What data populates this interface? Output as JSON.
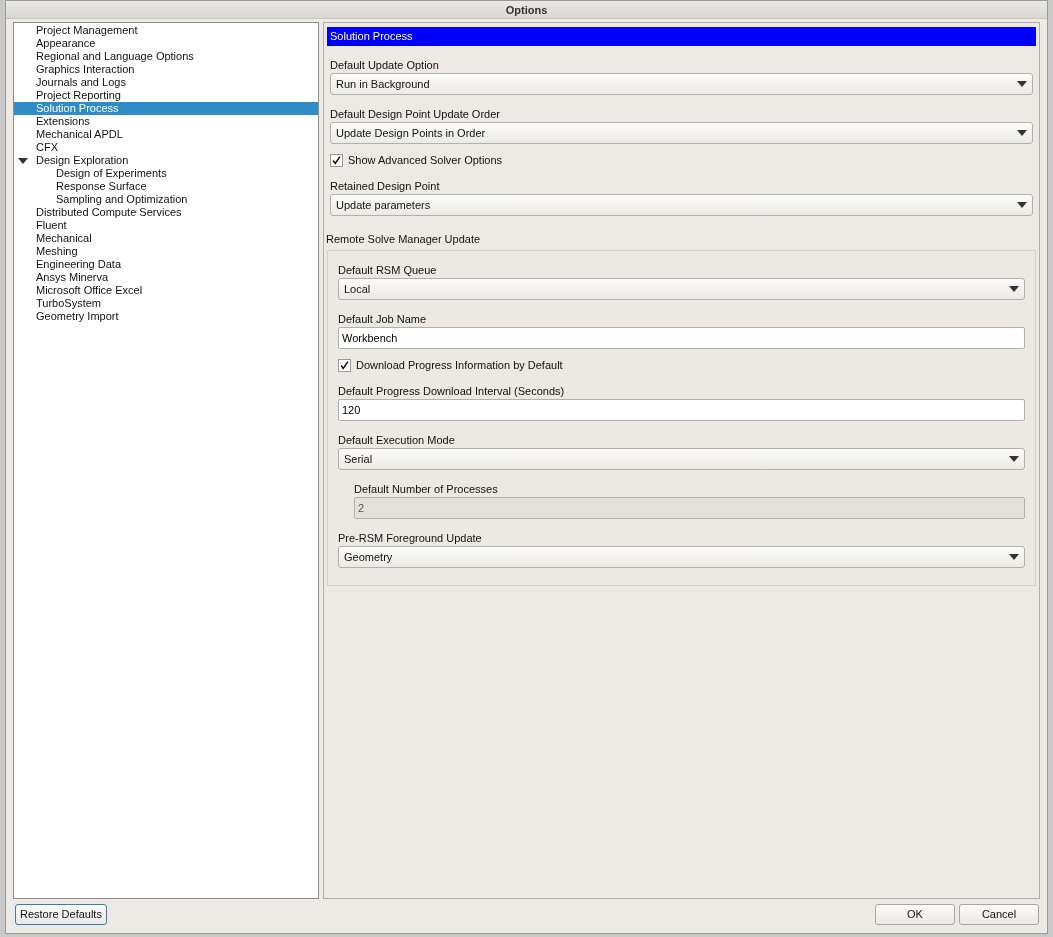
{
  "window": {
    "title": "Options"
  },
  "tree": [
    {
      "label": "Project Management",
      "selected": false
    },
    {
      "label": "Appearance",
      "selected": false
    },
    {
      "label": "Regional and Language Options",
      "selected": false
    },
    {
      "label": "Graphics Interaction",
      "selected": false
    },
    {
      "label": "Journals and Logs",
      "selected": false
    },
    {
      "label": "Project Reporting",
      "selected": false
    },
    {
      "label": "Solution Process",
      "selected": true
    },
    {
      "label": "Extensions",
      "selected": false
    },
    {
      "label": "Mechanical APDL",
      "selected": false
    },
    {
      "label": "CFX",
      "selected": false
    },
    {
      "label": "Design Exploration",
      "selected": false,
      "expanded": true,
      "children": [
        {
          "label": "Design of Experiments",
          "selected": false
        },
        {
          "label": "Response Surface",
          "selected": false
        },
        {
          "label": "Sampling and Optimization",
          "selected": false
        }
      ]
    },
    {
      "label": "Distributed Compute Services",
      "selected": false
    },
    {
      "label": "Fluent",
      "selected": false
    },
    {
      "label": "Mechanical",
      "selected": false
    },
    {
      "label": "Meshing",
      "selected": false
    },
    {
      "label": "Engineering Data",
      "selected": false
    },
    {
      "label": "Ansys Minerva",
      "selected": false
    },
    {
      "label": "Microsoft Office Excel",
      "selected": false
    },
    {
      "label": "TurboSystem",
      "selected": false
    },
    {
      "label": "Geometry Import",
      "selected": false
    }
  ],
  "panel": {
    "header": "Solution Process",
    "fields": [
      {
        "kind": "select",
        "label": "Default Update Option",
        "value": "Run in Background"
      },
      {
        "kind": "select",
        "label": "Default Design Point Update Order",
        "value": "Update Design Points in Order"
      },
      {
        "kind": "checkbox",
        "label": "Show Advanced Solver Options",
        "checked": true
      },
      {
        "kind": "select",
        "label": "Retained Design Point",
        "value": "Update parameters"
      }
    ],
    "group": {
      "title": "Remote Solve Manager Update",
      "fields": [
        {
          "kind": "select",
          "label": "Default RSM Queue",
          "value": "Local"
        },
        {
          "kind": "text",
          "label": "Default Job Name",
          "value": "Workbench",
          "disabled": false
        },
        {
          "kind": "checkbox",
          "label": "Download Progress Information by Default",
          "checked": true
        },
        {
          "kind": "text",
          "label": "Default Progress Download Interval (Seconds)",
          "value": "120",
          "disabled": false
        },
        {
          "kind": "select",
          "label": "Default Execution Mode",
          "value": "Serial",
          "children": [
            {
              "kind": "text",
              "label": "Default Number of Processes",
              "value": "2",
              "disabled": true
            }
          ]
        },
        {
          "kind": "select",
          "label": "Pre-RSM Foreground Update",
          "value": "Geometry"
        }
      ]
    }
  },
  "buttons": [
    {
      "kind": "left",
      "label": "Restore Defaults"
    },
    {
      "kind": "right",
      "label": "OK"
    },
    {
      "kind": "right",
      "label": "Cancel"
    }
  ]
}
